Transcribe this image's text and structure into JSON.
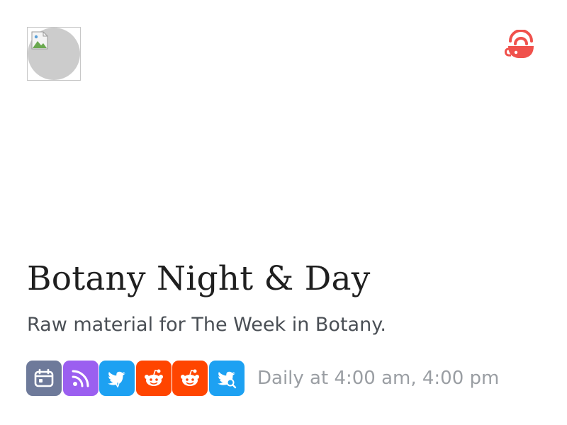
{
  "header": {
    "avatar_icon": "broken-image-icon",
    "logo_icon": "steaming-cup-logo",
    "logo_color": "#f0514c"
  },
  "feed": {
    "title": "Botany Night & Day",
    "description": "Raw material for The Week in Botany.",
    "schedule": "Daily at 4:00 am, 4:00 pm"
  },
  "actions": [
    {
      "id": "calendar",
      "icon": "calendar-icon",
      "color": "#6e7a9a"
    },
    {
      "id": "rss",
      "icon": "rss-icon",
      "color": "#9b5ff0"
    },
    {
      "id": "twitter-reply",
      "icon": "twitter-bird-icon",
      "color": "#1da1f2"
    },
    {
      "id": "reddit-1",
      "icon": "reddit-icon",
      "color": "#ff4500"
    },
    {
      "id": "reddit-2",
      "icon": "reddit-icon",
      "color": "#ff4500"
    },
    {
      "id": "twitter-search",
      "icon": "twitter-search-icon",
      "color": "#1da1f2"
    }
  ]
}
